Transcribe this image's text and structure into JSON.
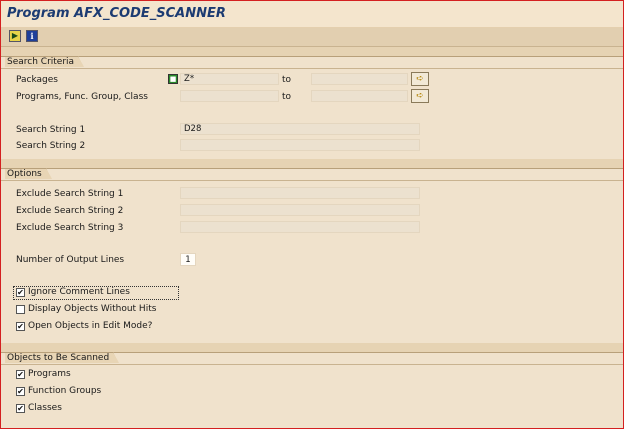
{
  "title": "Program AFX_CODE_SCANNER",
  "toolbar": {
    "execute_icon": "execute-icon",
    "info_glyph": "i"
  },
  "search_criteria": {
    "header": "Search Criteria",
    "packages_label": "Packages",
    "packages_from": "Z*",
    "packages_to": "",
    "programs_label": "Programs, Func. Group, Class",
    "programs_from": "",
    "programs_to": "",
    "to_label": "to",
    "search_string_1_label": "Search String 1",
    "search_string_1_value": "D28",
    "search_string_2_label": "Search String 2",
    "search_string_2_value": ""
  },
  "options": {
    "header": "Options",
    "exclude_1_label": "Exclude Search String 1",
    "exclude_2_label": "Exclude Search String 2",
    "exclude_3_label": "Exclude Search String 3",
    "output_lines_label": "Number of Output Lines",
    "output_lines_value": "1",
    "ignore_comment": {
      "label": "Ignore Comment Lines",
      "checked": true
    },
    "display_without_hits": {
      "label": "Display Objects Without Hits",
      "checked": false
    },
    "open_edit_mode": {
      "label": "Open Objects in Edit Mode?",
      "checked": true
    }
  },
  "objects": {
    "header": "Objects to Be Scanned",
    "programs": {
      "label": "Programs",
      "checked": true
    },
    "function_groups": {
      "label": "Function Groups",
      "checked": true
    },
    "classes": {
      "label": "Classes",
      "checked": true
    }
  },
  "glyphs": {
    "check": "✔",
    "arrow": "➪",
    "select": "⊞"
  }
}
